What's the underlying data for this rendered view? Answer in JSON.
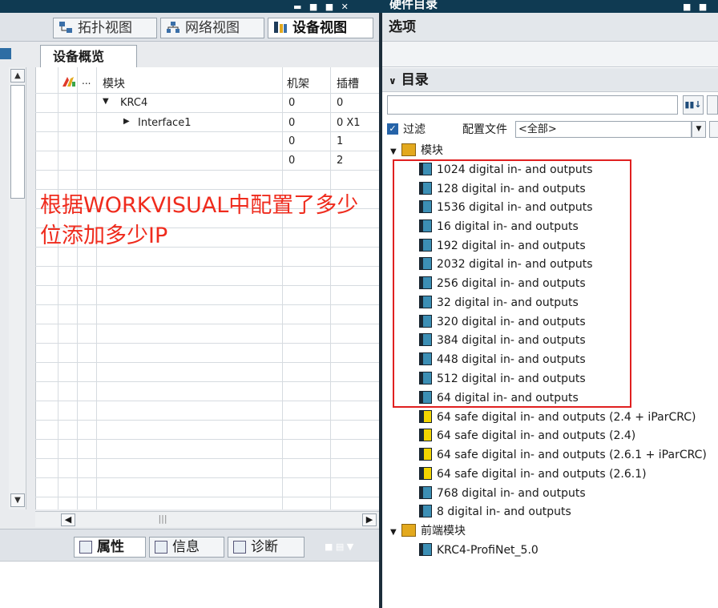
{
  "top_bar": {
    "right_title": "硬件目录",
    "left_controls": "▬ ■ ■ ✕",
    "right_controls": "■ ■"
  },
  "view_tabs": [
    {
      "label": "拓扑视图",
      "icon": "topology-icon"
    },
    {
      "label": "网络视图",
      "icon": "network-icon"
    },
    {
      "label": "设备视图",
      "icon": "device-icon"
    }
  ],
  "device_overview": {
    "tab_label": "设备概览",
    "columns": {
      "info": "...",
      "module": "模块",
      "rack": "机架",
      "slot": "插槽"
    },
    "rows": [
      {
        "module": "KRC4",
        "expander": "▼",
        "rack": "0",
        "slot": "0"
      },
      {
        "module": "Interface1",
        "expander": "▶",
        "rack": "0",
        "slot": "0 X1"
      },
      {
        "module": "",
        "expander": "",
        "rack": "0",
        "slot": "1"
      },
      {
        "module": "",
        "expander": "",
        "rack": "0",
        "slot": "2"
      }
    ]
  },
  "annotation": "根据WORKVISUAL中配置了多少位添加多少IP",
  "bottom_tabs": [
    {
      "label": "属性",
      "icon": "properties-icon"
    },
    {
      "label": "信息",
      "icon": "info-icon"
    },
    {
      "label": "诊断",
      "icon": "diagnostics-icon"
    }
  ],
  "right_panel": {
    "options_label": "选项",
    "catalog_label": "目录",
    "search_value": "",
    "filter_label": "过滤",
    "profile_label": "配置文件",
    "profile_value": "<全部>",
    "folders": [
      {
        "label": "模块",
        "items": [
          {
            "label": "1024 digital in- and outputs",
            "type": "standard"
          },
          {
            "label": "128 digital in- and outputs",
            "type": "standard"
          },
          {
            "label": "1536 digital in- and outputs",
            "type": "standard"
          },
          {
            "label": "16 digital in- and outputs",
            "type": "standard"
          },
          {
            "label": "192 digital in- and outputs",
            "type": "standard"
          },
          {
            "label": "2032 digital in- and outputs",
            "type": "standard"
          },
          {
            "label": "256 digital in- and outputs",
            "type": "standard"
          },
          {
            "label": "32 digital in- and outputs",
            "type": "standard"
          },
          {
            "label": "320 digital in- and outputs",
            "type": "standard"
          },
          {
            "label": "384 digital in- and outputs",
            "type": "standard"
          },
          {
            "label": "448 digital in- and outputs",
            "type": "standard"
          },
          {
            "label": "512 digital in- and outputs",
            "type": "standard"
          },
          {
            "label": "64 digital in- and outputs",
            "type": "standard"
          },
          {
            "label": "64 safe digital in- and outputs (2.4 + iParCRC)",
            "type": "safe"
          },
          {
            "label": "64 safe digital in- and outputs (2.4)",
            "type": "safe"
          },
          {
            "label": "64 safe digital in- and outputs (2.6.1 + iParCRC)",
            "type": "safe"
          },
          {
            "label": "64 safe digital in- and outputs (2.6.1)",
            "type": "safe"
          },
          {
            "label": "768 digital in- and outputs",
            "type": "standard"
          },
          {
            "label": "8 digital in- and outputs",
            "type": "standard"
          }
        ]
      },
      {
        "label": "前端模块",
        "items": [
          {
            "label": "KRC4-ProfiNet_5.0",
            "type": "standard"
          }
        ]
      }
    ]
  },
  "colors": {
    "annotation": "#ef2b1d",
    "highlight_box": "#e02020",
    "safe_module": "#f2d500",
    "standard_module": "#3c8fb5"
  }
}
